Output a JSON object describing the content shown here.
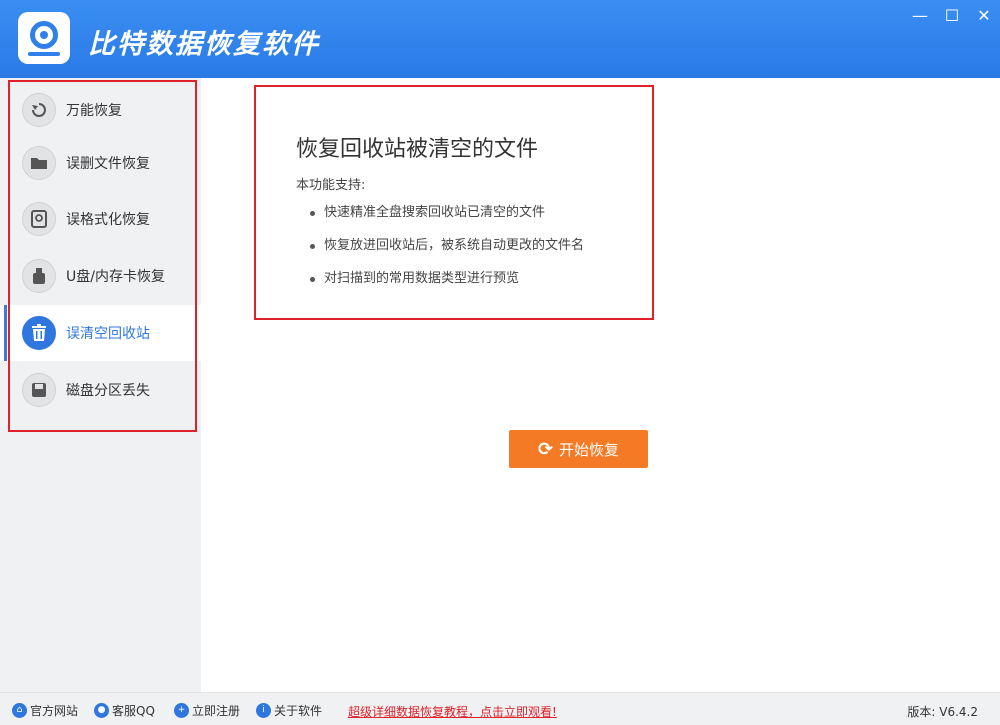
{
  "app": {
    "title": "比特数据恢复软件",
    "controls": {
      "minimize": "—",
      "maximize": "☐",
      "close": "✕"
    }
  },
  "sidebar": {
    "items": [
      {
        "label": "万能恢复",
        "icon": "rotate-icon",
        "active": false
      },
      {
        "label": "误删文件恢复",
        "icon": "folder-icon",
        "active": false
      },
      {
        "label": "误格式化恢复",
        "icon": "disk-format-icon",
        "active": false
      },
      {
        "label": "U盘/内存卡恢复",
        "icon": "usb-icon",
        "active": false
      },
      {
        "label": "误清空回收站",
        "icon": "trash-icon",
        "active": true
      },
      {
        "label": "磁盘分区丢失",
        "icon": "floppy-disk-icon",
        "active": false
      }
    ]
  },
  "main": {
    "feature_title": "恢复回收站被清空的文件",
    "feature_subtitle": "本功能支持:",
    "features": [
      "快速精准全盘搜索回收站已清空的文件",
      "恢复放进回收站后，被系统自动更改的文件名",
      "对扫描到的常用数据类型进行预览"
    ],
    "start_button": "开始恢复"
  },
  "statusbar": {
    "links": [
      {
        "label": "官方网站",
        "icon": "home-icon"
      },
      {
        "label": "客服QQ",
        "icon": "qq-icon"
      },
      {
        "label": "立即注册",
        "icon": "user-add-icon"
      },
      {
        "label": "关于软件",
        "icon": "info-icon"
      }
    ],
    "promo": "超级详细数据恢复教程，点击立即观看!",
    "version": "版本: V6.4.2"
  },
  "colors": {
    "titlebar": "#2f80ea",
    "accent": "#2f77de",
    "start_button": "#f57a25",
    "highlight_frame": "#e0212a"
  }
}
